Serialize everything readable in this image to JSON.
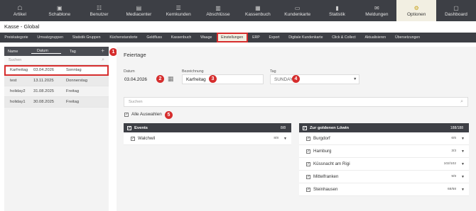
{
  "topnav": [
    {
      "label": "Artikel",
      "icon": "☖"
    },
    {
      "label": "Schablone",
      "icon": "▣"
    },
    {
      "label": "Benutzer",
      "icon": "☷"
    },
    {
      "label": "Mediacenter",
      "icon": "▤"
    },
    {
      "label": "Kernkunden",
      "icon": "☰"
    },
    {
      "label": "Abschlüsse",
      "icon": "▥"
    },
    {
      "label": "Kassenbuch",
      "icon": "▦"
    },
    {
      "label": "Kundenkarte",
      "icon": "▭"
    },
    {
      "label": "Statistik",
      "icon": "▮"
    },
    {
      "label": "Meldungen",
      "icon": "✉"
    },
    {
      "label": "Optionen",
      "icon": "⚙"
    },
    {
      "label": "Dashboard",
      "icon": "▢"
    }
  ],
  "breadcrumb": "Kasse - Global",
  "subnav": [
    "Preiskategorie",
    "Umsatzgruppen",
    "Statistik Gruppen",
    "Küchenstandorte",
    "Geldfluss",
    "Kassenbuch",
    "Waage",
    "Einstellungen",
    "ERP",
    "Export",
    "Digitale Kundenkarte",
    "Click & Collect",
    "Aktualisieren",
    "Übersetzungen"
  ],
  "list": {
    "headers": {
      "name": "Name",
      "date": "Datum",
      "day": "Tag",
      "add": "+"
    },
    "search_placeholder": "Suchen",
    "rows": [
      {
        "name": "Karfreitag",
        "date": "03.04.2026",
        "day": "Sonntag"
      },
      {
        "name": "test",
        "date": "13.11.2025",
        "day": "Donnerstag"
      },
      {
        "name": "holiday2",
        "date": "31.08.2025",
        "day": "Freitag"
      },
      {
        "name": "holiday1",
        "date": "30.08.2025",
        "day": "Freitag"
      }
    ]
  },
  "form": {
    "title": "Feiertage",
    "date_label": "Datum",
    "date_value": "03.04.2026",
    "name_label": "Bezeichnung",
    "name_value": "Karfreitag",
    "day_label": "Tag",
    "day_value": "SUNDAY",
    "search_placeholder": "Suchen",
    "select_all": "Alle Auswahlen"
  },
  "events_panel": {
    "title": "Events",
    "count": "8/8",
    "items": [
      {
        "label": "Walchwil",
        "count": "8/8"
      }
    ]
  },
  "locations_panel": {
    "title": "Zur goldenen Löwin",
    "count": "188/188",
    "items": [
      {
        "label": "Burgdorf",
        "count": "6/6"
      },
      {
        "label": "Hamburg",
        "count": "3/3"
      },
      {
        "label": "Küssnacht am Rigi",
        "count": "102/102"
      },
      {
        "label": "Mittelfranken",
        "count": "9/9"
      },
      {
        "label": "Steinhausen",
        "count": "68/68"
      }
    ]
  },
  "badges": [
    "1",
    "2",
    "3",
    "4",
    "5"
  ],
  "colors": {
    "nav_bg": "#3d3f45",
    "active_bg": "#f2efe2",
    "highlight": "#d62d2d",
    "accent": "#c7a21a"
  }
}
